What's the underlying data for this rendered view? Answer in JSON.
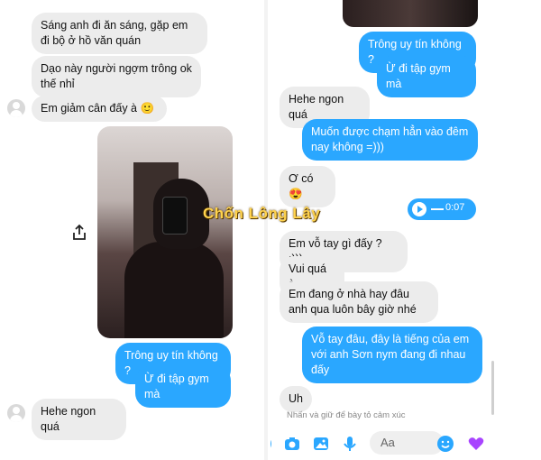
{
  "left": {
    "messages": [
      {
        "text": "Sáng anh đi ăn sáng, gặp em đi bộ ở hồ văn quán"
      },
      {
        "text": "Dạo này người ngợm trông ok thế nhỉ"
      },
      {
        "text": "Em giảm cân đấy à 🙂"
      },
      {
        "text": "Trông uy tín không ?"
      },
      {
        "text": "Ừ đi tập gym mà"
      },
      {
        "text": "Hehe ngon quá"
      }
    ]
  },
  "right": {
    "messages": [
      {
        "text": "Trông uy tín không ?"
      },
      {
        "text": "Ừ đi tập gym mà"
      },
      {
        "text": "Hehe ngon quá"
      },
      {
        "text": "Muốn được chạm hẳn vào đêm nay không =)))"
      },
      {
        "text": "Ơ có 😍"
      },
      {
        "text": "Em vỗ tay gì đấy ? :)))"
      },
      {
        "text": "Vui quá à"
      },
      {
        "text": "Em đang ở nhà hay đâu anh qua luôn bây giờ nhé"
      },
      {
        "text": "Vỗ tay đâu, đây là tiếng của em với anh Sơn nym đang đi nhau đấy"
      },
      {
        "text": "Uh"
      }
    ],
    "audio_time": "0:07",
    "hint": "Nhấn và giữ để bày tỏ cảm xúc",
    "input_placeholder": "Aa"
  },
  "watermark": "Chốn Lông Lây",
  "colors": {
    "accent": "#2aa7ff",
    "bubble_in": "#ececec"
  },
  "icons": [
    "share-icon",
    "plus-icon",
    "camera-icon",
    "image-icon",
    "mic-icon",
    "emoji-icon",
    "heart-icon",
    "play-icon"
  ]
}
